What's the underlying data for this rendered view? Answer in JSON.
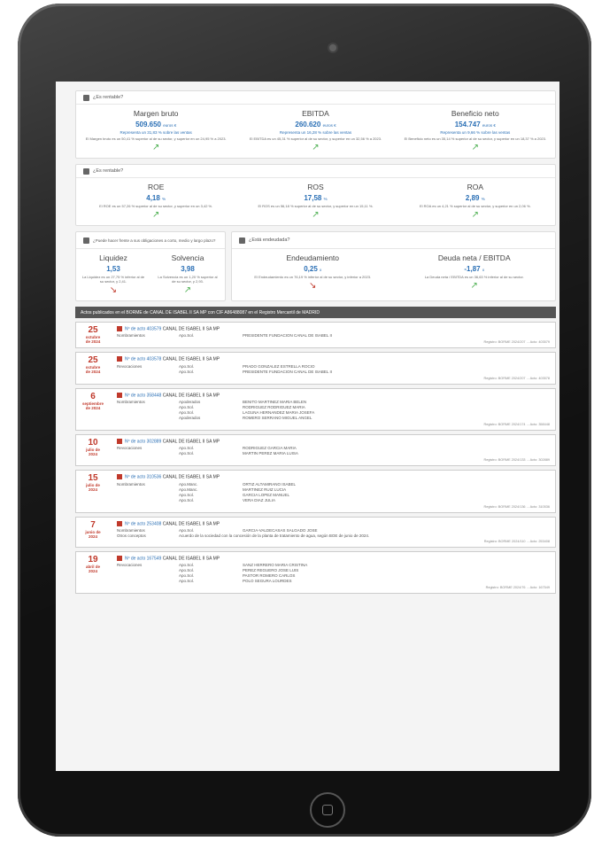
{
  "section1": {
    "title": "¿Es rentable?",
    "kpis": [
      {
        "title": "Margen bruto",
        "value": "509.650",
        "unit": "euros €",
        "sub": "Representa un 31,83 % sobre las ventas",
        "desc": "El Margen bruto es un 50,41 % superior al de su sector, y superior en un 24,95 % a 2023.",
        "trend": "up"
      },
      {
        "title": "EBITDA",
        "value": "260.620",
        "unit": "euros €",
        "sub": "Representa un 16,28 % sobre las ventas",
        "desc": "El EBITDA es un 45,31 % superior al de su sector, y superior en un 32,56 % a 2023.",
        "trend": "up"
      },
      {
        "title": "Beneficio neto",
        "value": "154.747",
        "unit": "euros €",
        "sub": "Representa un 9,66 % sobre las ventas",
        "desc": "El Beneficio neto es un 35,14 % superior al de su sector, y superior en un 18,37 % a 2023.",
        "trend": "up"
      }
    ]
  },
  "section2": {
    "title": "¿Es rentable?",
    "kpis": [
      {
        "title": "ROE",
        "value": "4,18",
        "unit": "%",
        "desc": "El ROE es un 57,26 % superior al de su sector, y superior en un 3,42 %.",
        "trend": "up"
      },
      {
        "title": "ROS",
        "value": "17,58",
        "unit": "%",
        "desc": "El ROS es un 56,18 % superior al de su sector, y superior en un 15,11 %.",
        "trend": "up"
      },
      {
        "title": "ROA",
        "value": "2,89",
        "unit": "%",
        "desc": "El ROA es un 4,21 % superior al de su sector, y superior en un 2,06 %.",
        "trend": "up"
      }
    ]
  },
  "section3": {
    "title": "¿Puede hacer frente a sus obligaciones a corto, medio y largo plazo?",
    "kpis": [
      {
        "title": "Liquidez",
        "value": "1,53",
        "desc": "La Liquidez es un 27,75 % inferior al de su sector, y 2,41.",
        "trend": "down"
      },
      {
        "title": "Solvencia",
        "value": "3,98",
        "desc": "La Solvencia es un 1,20 % superior al de su sector, y 2,93.",
        "trend": "up"
      }
    ]
  },
  "section4": {
    "title": "¿Está endeudada?",
    "kpis": [
      {
        "title": "Endeudamiento",
        "value": "0,25",
        "unit": "x",
        "desc": "El Endeudamiento es un 76,19 % inferior al de su sector, y inferior a 2023.",
        "trend": "down"
      },
      {
        "title": "Deuda neta / EBITDA",
        "value": "-1,87",
        "unit": "x",
        "desc": "La Deuda neta / EBITDA es un 36,63 % inferior al de su sector.",
        "trend": "up"
      }
    ]
  },
  "acts_bar": "Actos publicados en el BORME de CANAL DE ISABEL II SA MP con CIF A86488087 en el Registro Mercantil de MADRID",
  "company": "CANAL DE ISABEL II SA MP",
  "acts": [
    {
      "day": "25",
      "month": "octubre",
      "year": "de 2024",
      "ref": "Nº de acto 403579",
      "type": "Nombramientos",
      "rows": [
        [
          "Apo.Sol.",
          "PRESIDENTE FUNDACION CANAL DE ISABEL II"
        ]
      ],
      "foot": "Registro: BORME 2024/207 ... Acto: 403579"
    },
    {
      "day": "25",
      "month": "octubre",
      "year": "de 2024",
      "ref": "Nº de acto 403578",
      "type": "Revocaciones",
      "rows": [
        [
          "Apo.Sol.",
          "PRADO GONZALEZ ESTRELLA ROCIO"
        ],
        [
          "Apo.Sol.",
          "PRESIDENTE FUNDACION CANAL DE ISABEL II"
        ]
      ],
      "foot": "Registro: BORME 2024/207 ... Acto: 403578"
    },
    {
      "day": "6",
      "month": "septiembre",
      "year": "de 2024",
      "ref": "Nº de acto 358448",
      "type": "Nombramientos",
      "rows": [
        [
          "Apoderados",
          "BENITO MARTINEZ MARIA BELEN"
        ],
        [
          "Apo.Sol.",
          "RODRIGUEZ RODRIGUEZ MARIA"
        ],
        [
          "Apo.Sol.",
          "LAGUNA HERNANDEZ MARIA JOSEFA"
        ],
        [
          "Apoderados",
          "ROMERO SERRANO MIGUEL ANGEL"
        ]
      ],
      "foot": "Registro: BORME 2024/174 ... Acto: 358448"
    },
    {
      "day": "10",
      "month": "julio de",
      "year": "2024",
      "ref": "Nº de acto 302889",
      "type": "Revocaciones",
      "rows": [
        [
          "Apo.Sol.",
          "RODRIGUEZ GARCIA MARIA"
        ],
        [
          "Apo.Sol.",
          "MARTIN PEREZ MARIA LUISA"
        ]
      ],
      "foot": "Registro: BORME 2024/133 ... Acto: 302889"
    },
    {
      "day": "15",
      "month": "julio de",
      "year": "2024",
      "ref": "Nº de acto 310536",
      "type": "Nombramientos",
      "rows": [
        [
          "Apo.Manc.",
          "ORTIZ ALTAMIRANO ISABEL"
        ],
        [
          "Apo.Manc.",
          "MARTINEZ RUIZ LUCIA"
        ],
        [
          "Apo.Sol.",
          "GARCIA LOPEZ MANUEL"
        ],
        [
          "Apo.Sol.",
          "VERA DIAZ JULIA"
        ]
      ],
      "foot": "Registro: BORME 2024/136 ... Acto: 310536"
    },
    {
      "day": "7",
      "month": "junio de",
      "year": "2024",
      "ref": "Nº de acto 253408",
      "type": "Nombramientos",
      "rows": [
        [
          "Apo.Sol.",
          "GARCIA-VALDECASAS SALGADO JOSE"
        ]
      ],
      "note": "Otros conceptos",
      "extra": "Acuerdo de la sociedad con la concesión de la planta de tratamiento de agua, según BOE de junio de 2024.",
      "foot": "Registro: BORME 2024/110 ... Acto: 253408"
    },
    {
      "day": "19",
      "month": "abril de",
      "year": "2024",
      "ref": "Nº de acto 167549",
      "type": "Revocaciones",
      "rows": [
        [
          "Apo.Sol.",
          "SANZ HERRERO MARIA CRISTINA"
        ],
        [
          "Apo.Sol.",
          "PEREZ REGUERO JOSE LUIS"
        ],
        [
          "Apo.Sol.",
          "PASTOR ROMERO CARLOS"
        ],
        [
          "Apo.Sol.",
          "POLO SEGURA LOURDES"
        ]
      ],
      "foot": "Registro: BORME 2024/76 ... Acto: 167549"
    }
  ],
  "colors": {
    "accent": "#2a6fb5",
    "up": "#4caf50",
    "down": "#c0392b",
    "bar": "#555555"
  }
}
